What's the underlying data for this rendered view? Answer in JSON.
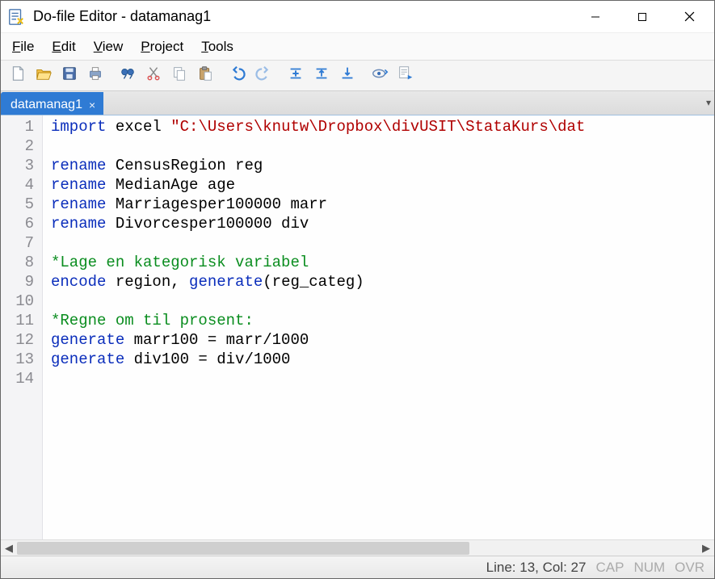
{
  "window": {
    "title": "Do-file Editor - datamanag1"
  },
  "menu": {
    "file": "File",
    "edit": "Edit",
    "view": "View",
    "project": "Project",
    "tools": "Tools"
  },
  "tabs": {
    "active": "datamanag1"
  },
  "code": {
    "num_lines": 14,
    "lines": [
      {
        "n": 1,
        "tokens": [
          {
            "cls": "kw",
            "t": "import"
          },
          {
            "cls": "",
            "t": " excel "
          },
          {
            "cls": "str",
            "t": "\"C:\\Users\\knutw\\Dropbox\\divUSIT\\StataKurs\\dat"
          }
        ]
      },
      {
        "n": 2,
        "tokens": []
      },
      {
        "n": 3,
        "tokens": [
          {
            "cls": "kw",
            "t": "rename"
          },
          {
            "cls": "",
            "t": " CensusRegion reg"
          }
        ]
      },
      {
        "n": 4,
        "tokens": [
          {
            "cls": "kw",
            "t": "rename"
          },
          {
            "cls": "",
            "t": " MedianAge age"
          }
        ]
      },
      {
        "n": 5,
        "tokens": [
          {
            "cls": "kw",
            "t": "rename"
          },
          {
            "cls": "",
            "t": " Marriagesper100000 marr"
          }
        ]
      },
      {
        "n": 6,
        "tokens": [
          {
            "cls": "kw",
            "t": "rename"
          },
          {
            "cls": "",
            "t": " Divorcesper100000 div"
          }
        ]
      },
      {
        "n": 7,
        "tokens": []
      },
      {
        "n": 8,
        "tokens": [
          {
            "cls": "cmt",
            "t": "*Lage en kategorisk variabel"
          }
        ]
      },
      {
        "n": 9,
        "tokens": [
          {
            "cls": "kw",
            "t": "encode"
          },
          {
            "cls": "",
            "t": " region, "
          },
          {
            "cls": "kw",
            "t": "generate"
          },
          {
            "cls": "",
            "t": "(reg_categ)"
          }
        ]
      },
      {
        "n": 10,
        "tokens": []
      },
      {
        "n": 11,
        "tokens": [
          {
            "cls": "cmt",
            "t": "*Regne om til prosent:"
          }
        ]
      },
      {
        "n": 12,
        "tokens": [
          {
            "cls": "kw",
            "t": "generate"
          },
          {
            "cls": "",
            "t": " marr100 = marr/1000"
          }
        ]
      },
      {
        "n": 13,
        "tokens": [
          {
            "cls": "kw",
            "t": "generate"
          },
          {
            "cls": "",
            "t": " div100 = div/1000"
          }
        ]
      },
      {
        "n": 14,
        "tokens": []
      }
    ]
  },
  "status": {
    "pos": "Line: 13, Col: 27",
    "cap": "CAP",
    "num": "NUM",
    "ovr": "OVR"
  },
  "toolbar_icons": [
    "new-icon",
    "open-icon",
    "save-icon",
    "print-icon",
    "find-icon",
    "cut-icon",
    "copy-icon",
    "paste-icon",
    "undo-icon",
    "redo-icon",
    "indent-icon",
    "outdent-icon",
    "bookmark-icon",
    "run-preview-icon",
    "run-icon"
  ]
}
